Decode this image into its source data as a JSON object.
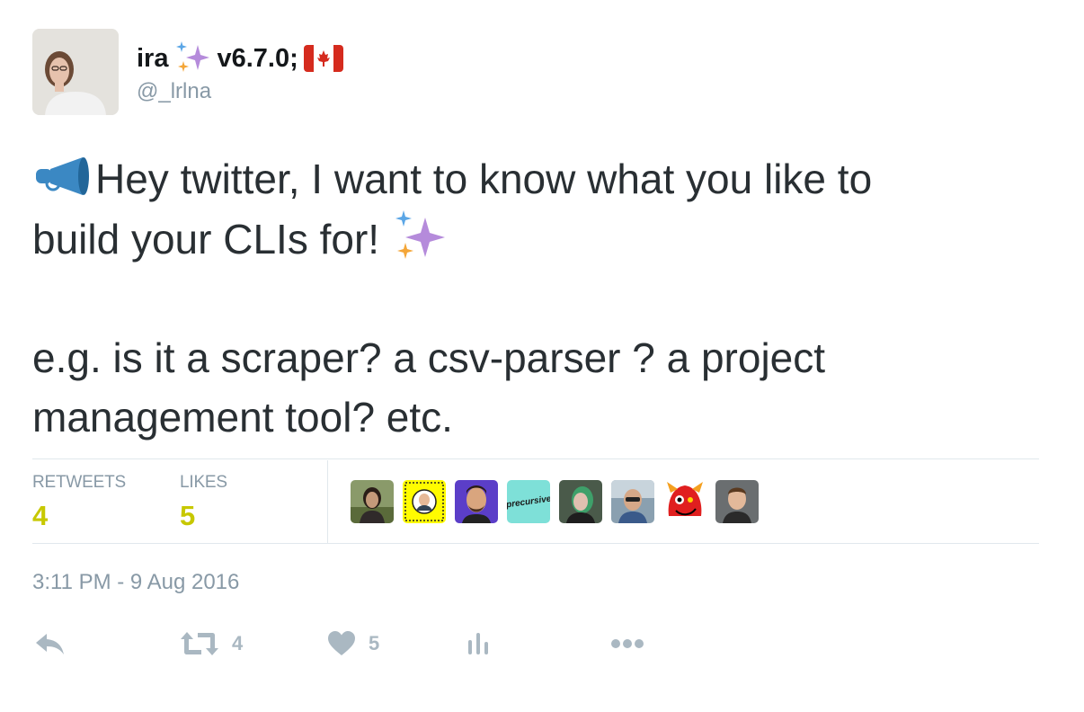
{
  "user": {
    "display_name": "ira",
    "version_text": "v6.7.0;",
    "handle": "@_lrlna",
    "avatar_icon": "profile-photo",
    "name_emojis": [
      "sparkles-icon",
      "canada-flag-icon"
    ]
  },
  "tweet": {
    "line1": "Hey twitter, I want to know what you like to",
    "line2": "build your CLIs for!",
    "line3": "e.g. is it a scraper? a csv-parser ? a project",
    "line4": "management tool? etc.",
    "emojis": [
      "megaphone-icon",
      "sparkles-icon"
    ]
  },
  "stats": {
    "retweets_label": "RETWEETS",
    "retweets_count": "4",
    "likes_label": "LIKES",
    "likes_count": "5"
  },
  "likers": [
    {
      "name": "liker-avatar-1",
      "text": ""
    },
    {
      "name": "liker-avatar-2-snapcode",
      "text": ""
    },
    {
      "name": "liker-avatar-3",
      "text": ""
    },
    {
      "name": "liker-avatar-4-precursive",
      "text": "precursive"
    },
    {
      "name": "liker-avatar-5",
      "text": ""
    },
    {
      "name": "liker-avatar-6",
      "text": ""
    },
    {
      "name": "liker-avatar-7",
      "text": ""
    },
    {
      "name": "liker-avatar-8",
      "text": ""
    }
  ],
  "timestamp": "3:11 PM - 9 Aug 2016",
  "actions": {
    "reply_icon": "reply-icon",
    "retweet_icon": "retweet-icon",
    "retweet_count": "4",
    "like_icon": "heart-icon",
    "like_count": "5",
    "analytics_icon": "analytics-icon",
    "more_icon": "more-icon"
  },
  "colors": {
    "text": "#292f33",
    "muted": "#8899a6",
    "count_accent": "#c7c800",
    "action_gray": "#aab8c2",
    "divider": "#e1e8ed"
  }
}
